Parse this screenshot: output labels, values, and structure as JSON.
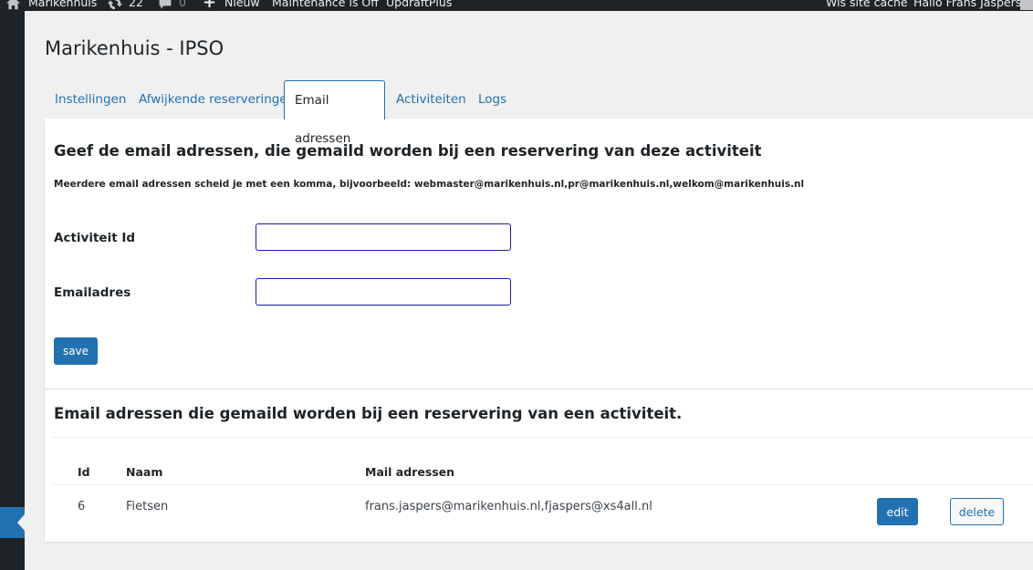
{
  "adminbar": {
    "site_name": "Marikenhuis",
    "updates_count": "22",
    "comments_count": "0",
    "new_label": "Nieuw",
    "maintenance_label": "Maintenance is Off",
    "updraft_label": "UpdraftPlus",
    "cache_label": "Wis site cache",
    "greeting": "Hallo Frans Jaspers"
  },
  "page": {
    "title": "Marikenhuis - IPSO"
  },
  "tabs": [
    {
      "label": "Instellingen"
    },
    {
      "label": "Afwijkende reserveringen"
    },
    {
      "label": "Email adressen",
      "active": true
    },
    {
      "label": "Activiteiten"
    },
    {
      "label": "Logs"
    }
  ],
  "form": {
    "heading": "Geef de email adressen, die gemaild worden bij een reservering van deze activiteit",
    "hint": "Meerdere email adressen scheid je met een komma, bijvoorbeeld: webmaster@marikenhuis.nl,pr@marikenhuis.nl,welkom@marikenhuis.nl",
    "activity_id_label": "Activiteit Id",
    "activity_id_value": "",
    "email_label": "Emailadres",
    "email_value": "",
    "save_label": "save"
  },
  "list": {
    "heading": "Email adressen die gemaild worden bij een reservering van een activiteit.",
    "columns": [
      "Id",
      "Naam",
      "Mail adressen"
    ],
    "rows": [
      {
        "id": "6",
        "naam": "Fietsen",
        "mail": "frans.jaspers@marikenhuis.nl,fjaspers@xs4all.nl",
        "edit_label": "edit",
        "delete_label": "delete"
      }
    ]
  },
  "colors": {
    "accent": "#2271b1",
    "adminbar_bg": "#1d2327",
    "input_border": "#1a1aa3"
  },
  "icons": [
    "home-icon",
    "updates-icon",
    "comments-icon",
    "plus-icon",
    "avatar-icon",
    "collapse-arrow-icon"
  ]
}
